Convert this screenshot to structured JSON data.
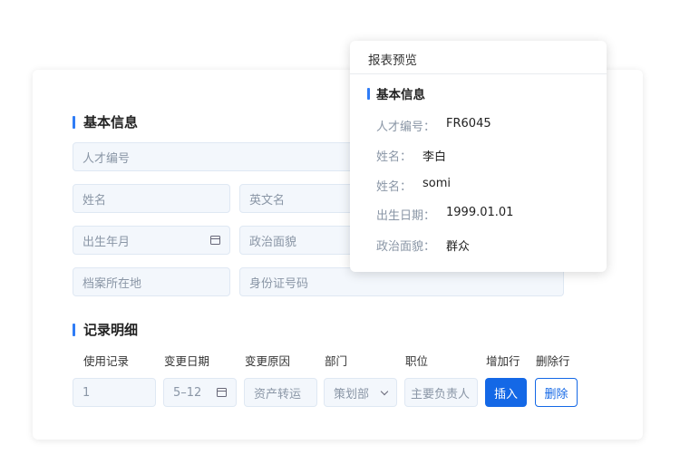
{
  "form": {
    "basic_section_title": "基本信息",
    "fields": {
      "talent_id": "人才编号",
      "name": "姓名",
      "english_name": "英文名",
      "birth": "出生年月",
      "political": "政治面貌",
      "archive_location": "档案所在地",
      "id_number": "身份证号码"
    },
    "records_section_title": "记录明细",
    "columns": [
      "使用记录",
      "变更日期",
      "变更原因",
      "部门",
      "职位",
      "增加行",
      "删除行"
    ],
    "row": {
      "usage_record": "1",
      "change_date": "5–12",
      "change_reason": "资产转运",
      "department": "策划部",
      "position": "主要负责人"
    },
    "insert_button": "插入",
    "delete_button": "删除"
  },
  "preview": {
    "title": "报表预览",
    "section_title": "基本信息",
    "rows": [
      {
        "key": "人才编号：",
        "value": "FR6045"
      },
      {
        "key": "姓名：",
        "value": "李白"
      },
      {
        "key": "姓名：",
        "value": "somi"
      },
      {
        "key": "出生日期：",
        "value": "1999.01.01"
      },
      {
        "key": "政治面貌：",
        "value": "群众"
      }
    ]
  },
  "colors": {
    "accent": "#1468e6",
    "section_bar": "#2f7cf6",
    "field_bg": "#f3f7fc"
  }
}
